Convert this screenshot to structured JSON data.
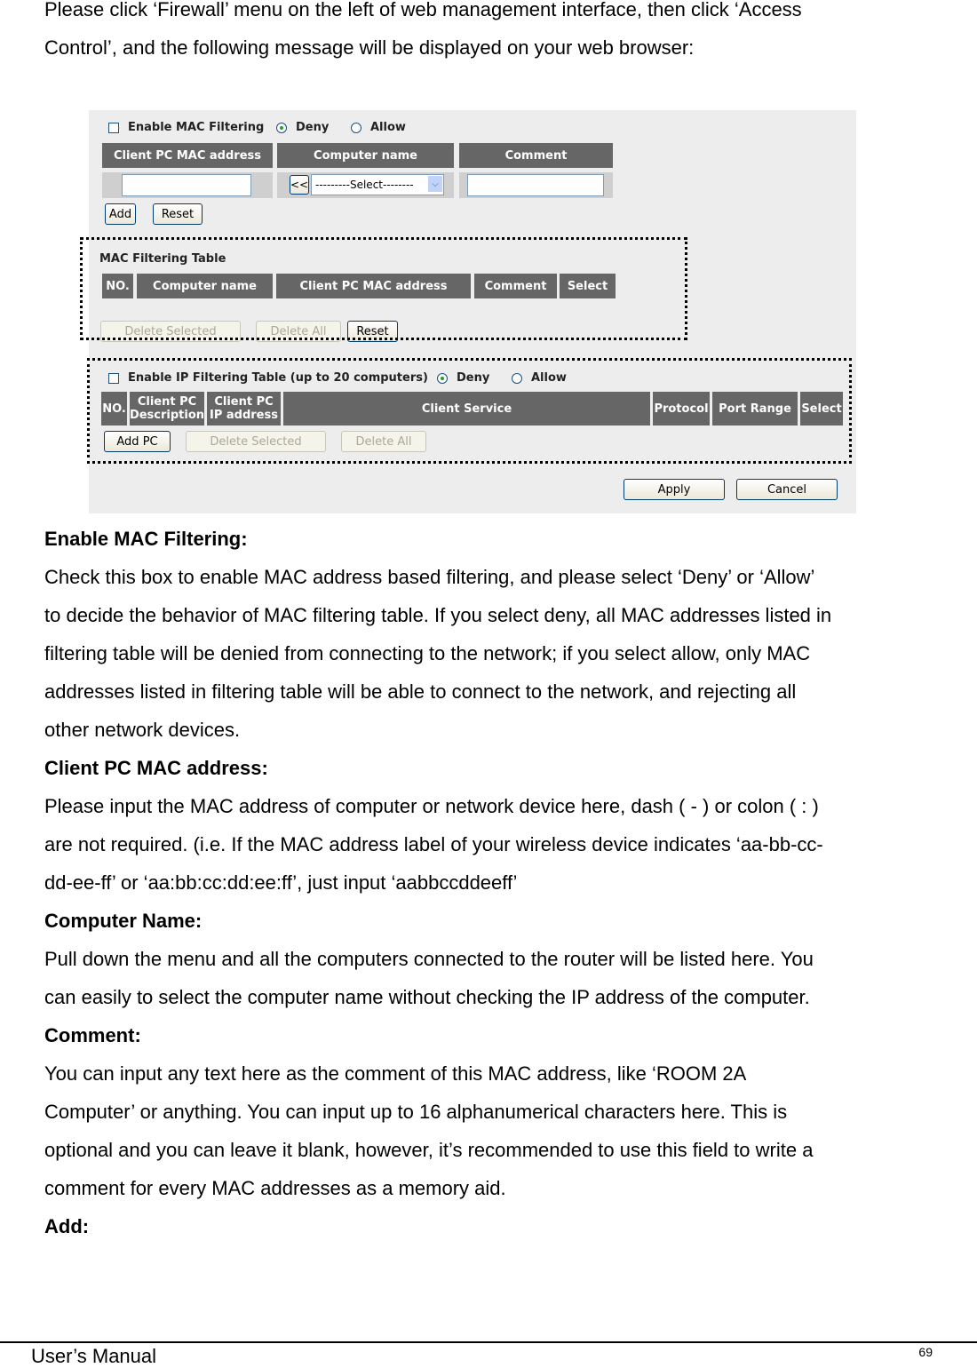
{
  "intro": {
    "line1": "Please click ‘Firewall’ menu on the left of web management interface, then click ‘Access",
    "line2": "Control’, and the following message will be displayed on your web browser:"
  },
  "screenshot": {
    "mac_filter": {
      "enable_label": "Enable MAC Filtering",
      "enabled": false,
      "deny_label": "Deny",
      "allow_label": "Allow",
      "selected_mode": "Deny",
      "headers": [
        "Client PC MAC address",
        "Computer name",
        "Comment"
      ],
      "mac_input_value": "",
      "copy_button": "<<",
      "computer_select_value": "---------Select--------",
      "comment_input_value": "",
      "add_button": "Add",
      "reset_button": "Reset"
    },
    "mac_table": {
      "title": "MAC Filtering Table",
      "headers": [
        "NO.",
        "Computer name",
        "Client PC MAC address",
        "Comment",
        "Select"
      ],
      "delete_selected_button": "Delete Selected",
      "delete_all_button": "Delete All",
      "reset_button": "Reset"
    },
    "ip_filter": {
      "enable_label": "Enable IP Filtering Table (up to 20 computers)",
      "enabled": false,
      "deny_label": "Deny",
      "allow_label": "Allow",
      "selected_mode": "Deny",
      "headers": [
        "NO.",
        "Client PC Description",
        "Client PC IP address",
        "Client Service",
        "Protocol",
        "Port Range",
        "Select"
      ],
      "add_pc_button": "Add PC",
      "delete_selected_button": "Delete Selected",
      "delete_all_button": "Delete All"
    },
    "apply_button": "Apply",
    "cancel_button": "Cancel"
  },
  "sections": [
    {
      "heading": "Enable MAC Filtering:",
      "lines": [
        "Check this box to enable MAC address based filtering, and please select ‘Deny’ or ‘Allow’",
        "to decide the behavior of MAC filtering table. If you select deny, all MAC addresses listed in",
        "filtering table will be denied from connecting to the network; if you select allow, only MAC",
        "addresses listed in filtering table will be able to connect to the network, and rejecting all",
        "other network devices."
      ]
    },
    {
      "heading": "Client PC MAC address:",
      "lines": [
        "Please input the MAC address of computer or network device here, dash ( - ) or colon ( : )",
        "are not required. (i.e. If the MAC address label of your wireless device indicates ‘aa-bb-cc-",
        "dd-ee-ff’ or ‘aa:bb:cc:dd:ee:ff’, just input ‘aabbccddeeff’"
      ]
    },
    {
      "heading": "Computer Name:",
      "lines": [
        "Pull down the menu and all the computers connected to the router will be listed here. You",
        "can easily to select the computer name without checking the IP address of the computer."
      ]
    },
    {
      "heading": "Comment:",
      "lines": [
        "You can input any text here as the comment of this MAC address, like ‘ROOM 2A",
        "Computer’ or anything. You can input up to 16 alphanumerical characters here. This is",
        "optional and you can leave it blank, however, it’s recommended to use this field to write a",
        "comment for every MAC addresses as a memory aid."
      ]
    },
    {
      "heading": "Add:",
      "lines": []
    }
  ],
  "footer": {
    "title": "User’s Manual",
    "page_number": "69"
  }
}
